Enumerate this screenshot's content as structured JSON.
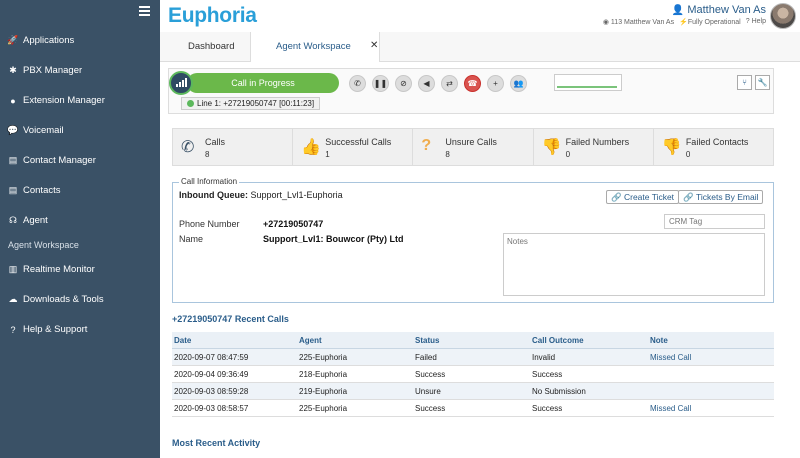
{
  "sidebar": {
    "items": [
      {
        "label": "Applications",
        "icon": "rocket-icon"
      },
      {
        "label": "PBX Manager",
        "icon": "asterisk-icon"
      },
      {
        "label": "Extension Manager",
        "icon": "user-circle-icon"
      },
      {
        "label": "Voicemail",
        "icon": "speech-bubble-icon"
      },
      {
        "label": "Contact Manager",
        "icon": "address-card-icon"
      },
      {
        "label": "Contacts",
        "icon": "address-card-icon"
      },
      {
        "label": "Agent",
        "icon": "headset-icon"
      },
      {
        "label": "Realtime Monitor",
        "icon": "chart-icon"
      },
      {
        "label": "Downloads & Tools",
        "icon": "cloud-download-icon"
      },
      {
        "label": "Help & Support",
        "icon": "question-circle-icon"
      }
    ],
    "sub_item": "Agent Workspace"
  },
  "header": {
    "logo": "Euphoria",
    "user_name": "Matthew Van As",
    "account": "113 Matthew Van As",
    "status": "Fully Operational",
    "help": "Help"
  },
  "tabs": [
    {
      "label": "Dashboard"
    },
    {
      "label": "Agent Workspace"
    }
  ],
  "tab_close": "✕",
  "callbar": {
    "status": "Call in Progress",
    "line": "Line 1: +27219050747 [00:11:23]"
  },
  "stats": [
    {
      "label": "Calls",
      "value": "8",
      "icon": "phone-icon",
      "color": "#3a5166"
    },
    {
      "label": "Successful Calls",
      "value": "1",
      "icon": "thumbs-up-icon",
      "color": "#5cb85c"
    },
    {
      "label": "Unsure Calls",
      "value": "8",
      "icon": "question-icon",
      "color": "#f0ad4e"
    },
    {
      "label": "Failed Numbers",
      "value": "0",
      "icon": "thumbs-down-icon",
      "color": "#d9534f"
    },
    {
      "label": "Failed Contacts",
      "value": "0",
      "icon": "thumbs-down-icon",
      "color": "#222222"
    }
  ],
  "call_info": {
    "legend": "Call Information",
    "queue_label": "Inbound Queue:",
    "queue_value": "Support_Lvl1-Euphoria",
    "create_ticket": "Create Ticket",
    "tickets_by_email": "Tickets By Email",
    "crm_placeholder": "CRM Tag",
    "phone_label": "Phone Number",
    "phone_value": "+27219050747",
    "name_label": "Name",
    "name_value": "Support_Lvl1: Bouwcor (Pty) Ltd",
    "notes_placeholder": "Notes"
  },
  "recent": {
    "title": "+27219050747 Recent Calls",
    "columns": [
      "Date",
      "Agent",
      "Status",
      "Call Outcome",
      "Note"
    ],
    "rows": [
      [
        "2020-09-07 08:47:59",
        "225-Euphoria",
        "Failed",
        "Invalid",
        "Missed Call"
      ],
      [
        "2020-09-04 09:36:49",
        "218-Euphoria",
        "Success",
        "Success",
        ""
      ],
      [
        "2020-09-03 08:59:28",
        "219-Euphoria",
        "Unsure",
        "No Submission",
        ""
      ],
      [
        "2020-09-03 08:58:57",
        "225-Euphoria",
        "Success",
        "Success",
        "Missed Call"
      ]
    ]
  },
  "activity_title": "Most Recent Activity",
  "colors": {
    "sidebar": "#3a5166",
    "accent": "#2a9fd8",
    "call_green": "#6bb84a",
    "link": "#2a5d8a"
  }
}
